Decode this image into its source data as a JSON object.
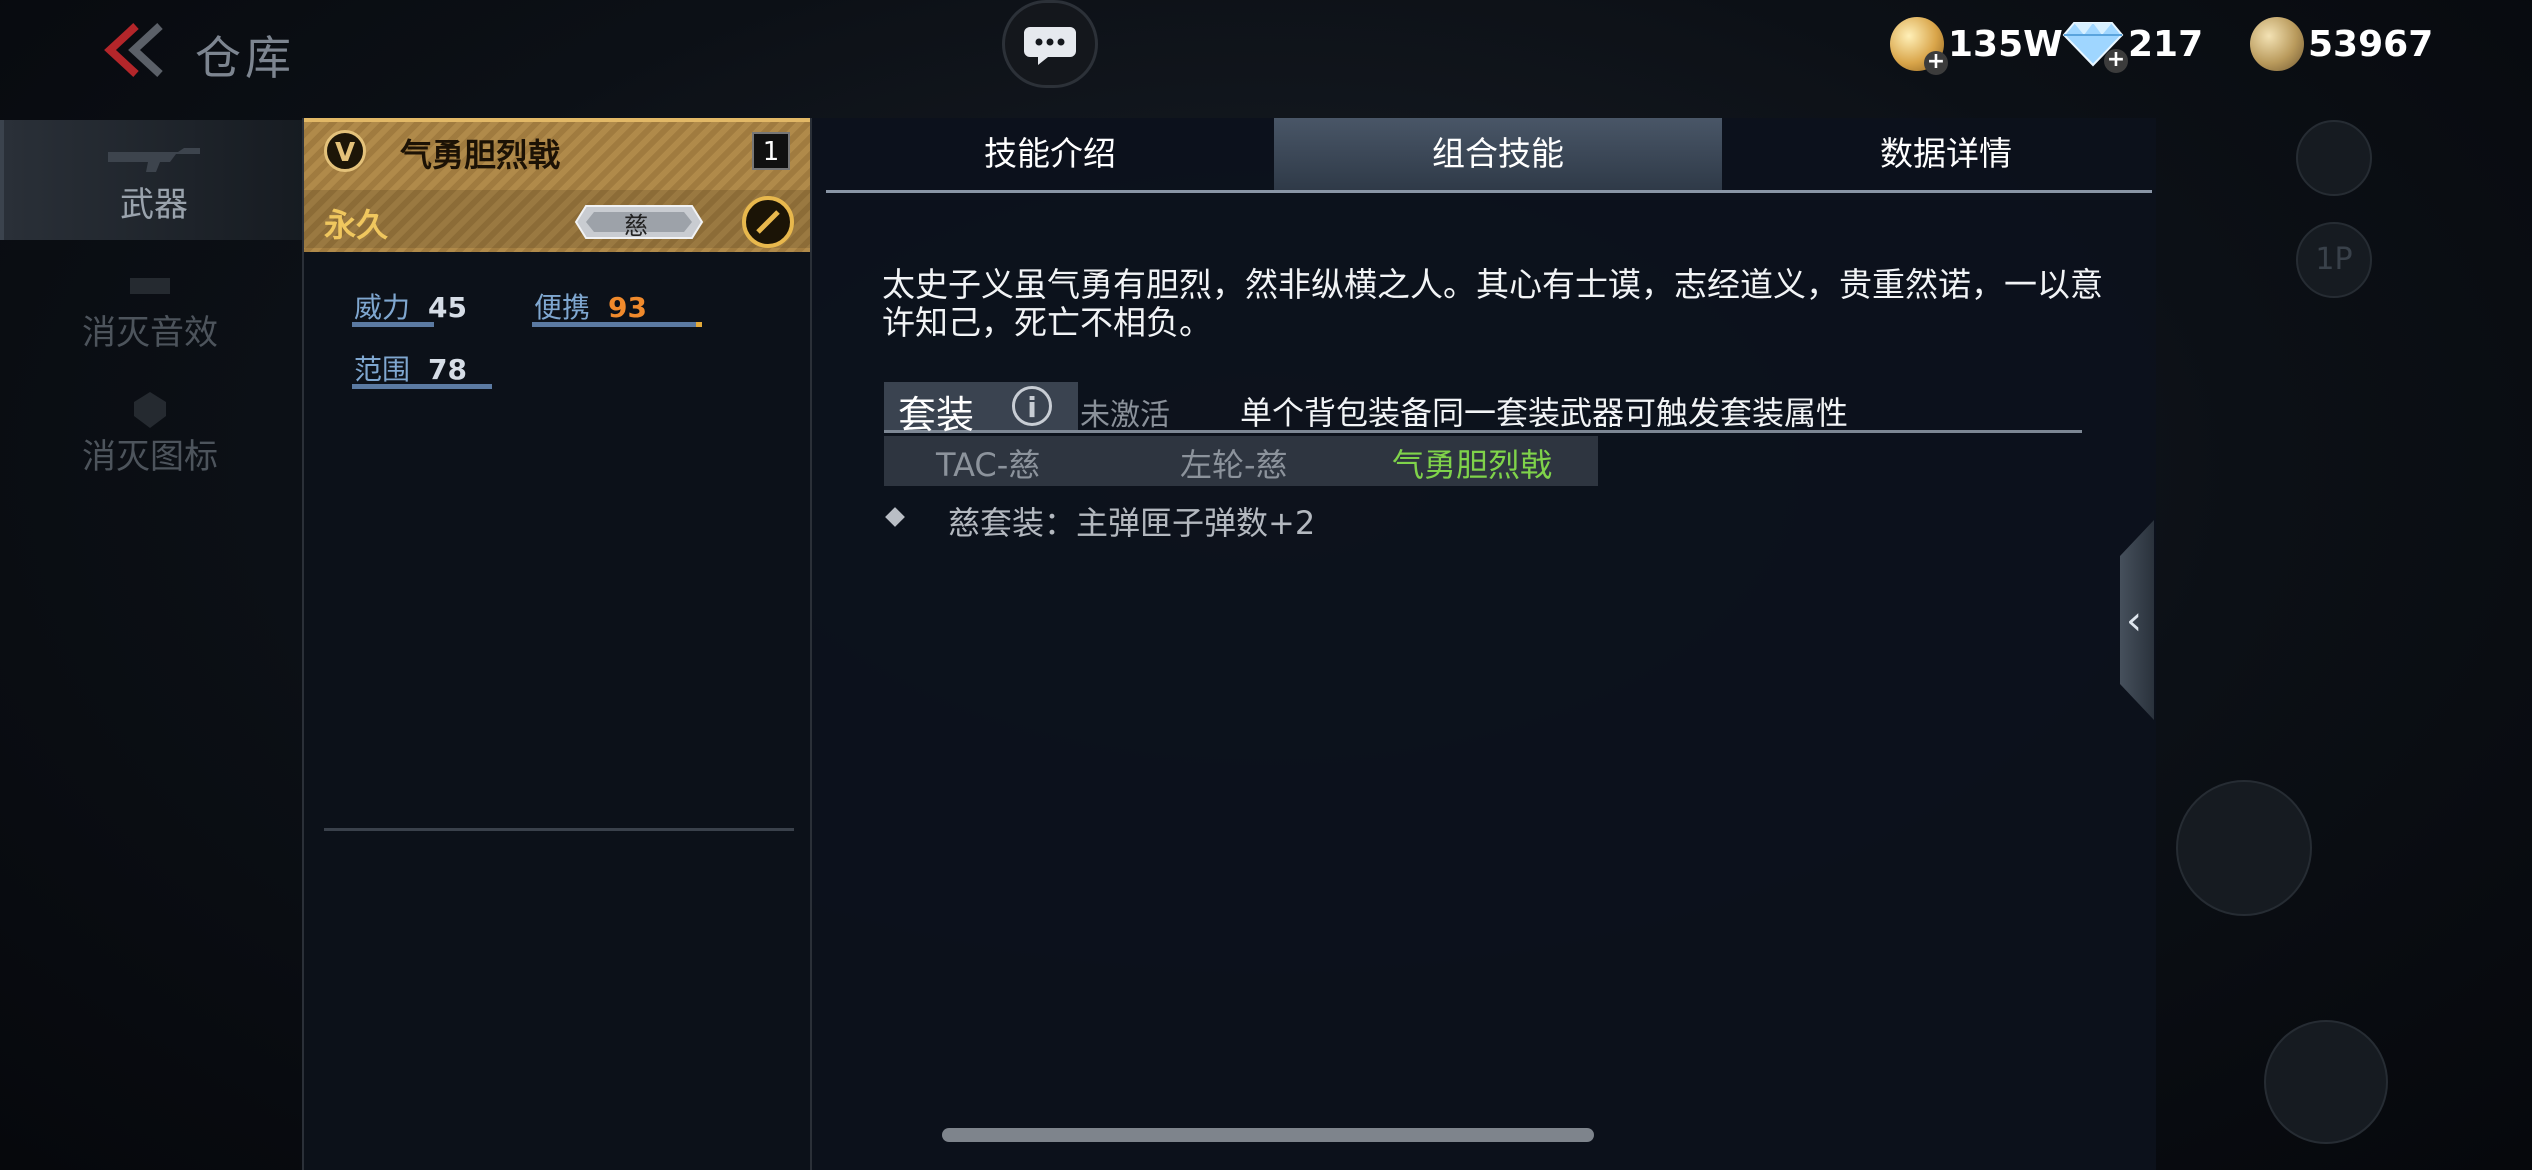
{
  "header": {
    "title": "仓库",
    "currencies": [
      {
        "icon": "gold-coin-icon",
        "value": "135W"
      },
      {
        "icon": "diamond-icon",
        "value": "217"
      },
      {
        "icon": "token-coin-icon",
        "value": "53967"
      }
    ]
  },
  "sidebar": {
    "items": [
      {
        "label": "武器",
        "active": true
      },
      {
        "label": "消灭音效",
        "active": false
      },
      {
        "label": "消灭图标",
        "active": false
      }
    ]
  },
  "item": {
    "rank_badge": "V",
    "name": "气勇胆烈戟",
    "count": "1",
    "duration": "永久",
    "set_tag": "慈",
    "stats": [
      {
        "label": "威力",
        "value": "45",
        "fill": 0.45
      },
      {
        "label": "便携",
        "value": "93",
        "fill": 0.93
      },
      {
        "label": "范围",
        "value": "78",
        "fill": 0.78
      }
    ]
  },
  "tabs": [
    {
      "label": "技能介绍",
      "active": false
    },
    {
      "label": "组合技能",
      "active": true
    },
    {
      "label": "数据详情",
      "active": false
    }
  ],
  "combo": {
    "description": "太史子义虽气勇有胆烈，然非纵横之人。其心有士谟，志经道义，贵重然诺，一以意许知己，死亡不相负。",
    "set_label": "套装",
    "set_status": "未激活",
    "set_hint": "单个背包装备同一套装武器可触发套装属性",
    "set_items": [
      "TAC-慈",
      "左轮-慈",
      "气勇胆烈戟"
    ],
    "bonus": "慈套装：主弹匣子弹数+2"
  },
  "colors": {
    "gold_header": "#b08a4a",
    "active_set_item": "#7fd34a",
    "carry_value": "#f08a2c",
    "stat_label": "#7fa7d0"
  },
  "side_handle_icon": "chevron-left-icon"
}
